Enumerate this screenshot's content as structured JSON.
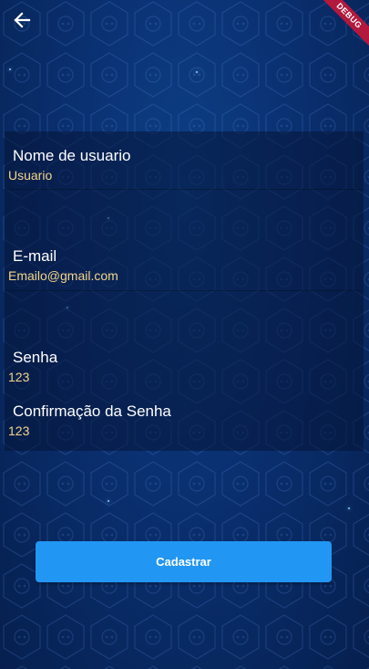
{
  "app": {
    "debug_banner": "DEBUG"
  },
  "form": {
    "username": {
      "label": "Nome de usuario",
      "value": "Usuario"
    },
    "email": {
      "label": "E-mail",
      "value": "Emailo@gmail.com"
    },
    "password": {
      "label": "Senha",
      "value": "123"
    },
    "password_confirm": {
      "label": "Confirmação da Senha",
      "value": "123"
    }
  },
  "actions": {
    "submit_label": "Cadastrar"
  },
  "icons": {
    "back": "arrow-left-icon"
  },
  "colors": {
    "button": "#2196f3",
    "value_text": "#f4d58a",
    "debug_banner": "#b3193d"
  }
}
